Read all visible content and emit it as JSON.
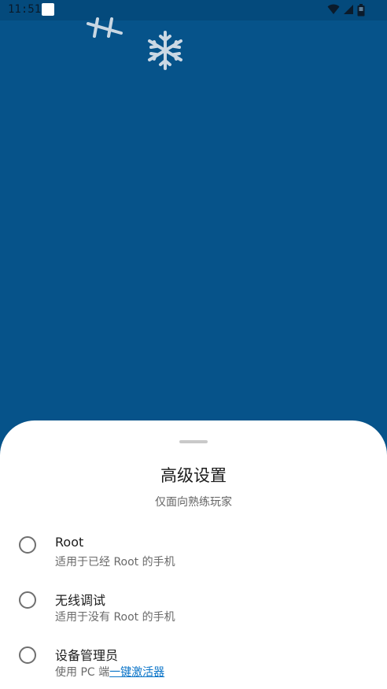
{
  "status_bar": {
    "time": "11:51",
    "icons": [
      "app-notification-icon",
      "wifi-icon",
      "cell-signal-icon",
      "battery-icon"
    ]
  },
  "colors": {
    "wallpaper": "#06538a",
    "sheet": "#ffffff",
    "link": "#0a74c8"
  },
  "sheet": {
    "title": "高级设置",
    "subtitle": "仅面向熟练玩家",
    "options": [
      {
        "label": "Root",
        "description": "适用于已经 Root 的手机"
      },
      {
        "label": "无线调试",
        "description": "适用于没有 Root 的手机"
      },
      {
        "label": "设备管理员",
        "description_prefix": "使用 PC 端",
        "description_link": "一键激活器"
      }
    ]
  }
}
